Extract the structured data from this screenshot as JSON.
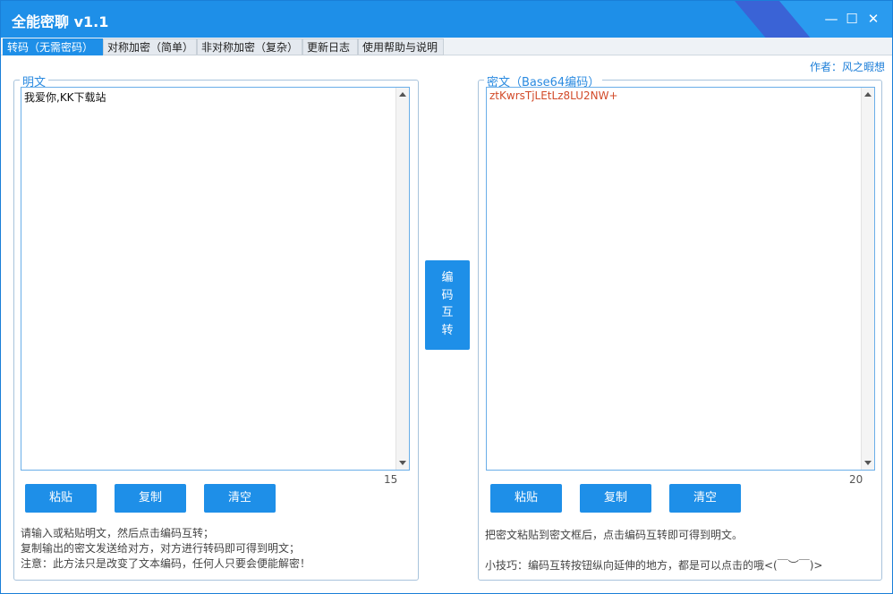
{
  "window": {
    "title": "全能密聊 v1.1",
    "minimize": "—",
    "maximize": "☐",
    "close": "✕"
  },
  "tabs": [
    {
      "label": "转码（无需密码）",
      "active": true
    },
    {
      "label": "对称加密（简单）",
      "active": false
    },
    {
      "label": "非对称加密（复杂）",
      "active": false
    },
    {
      "label": "更新日志",
      "active": false
    },
    {
      "label": "使用帮助与说明",
      "active": false
    }
  ],
  "author": "作者：风之暇想",
  "left": {
    "legend": "明文",
    "text": "我爱你,KK下载站",
    "count": "15",
    "buttons": {
      "paste": "粘贴",
      "copy": "复制",
      "clear": "清空"
    },
    "notes": [
      "请输入或粘贴明文，然后点击编码互转；",
      "复制输出的密文发送给对方，对方进行转码即可得到明文；",
      "注意：此方法只是改变了文本编码，任何人只要会便能解密！"
    ]
  },
  "middle": {
    "chars": [
      "编",
      "码",
      "互",
      "转"
    ]
  },
  "right": {
    "legend": "密文（Base64编码）",
    "text": "ztKwrsTjLEtLz8LU2NW+",
    "count": "20",
    "buttons": {
      "paste": "粘贴",
      "copy": "复制",
      "clear": "清空"
    },
    "notes": [
      "把密文粘贴到密文框后，点击编码互转即可得到明文。",
      "小技巧：编码互转按钮纵向延伸的地方，都是可以点击的哦<(￣︶￣)>"
    ]
  },
  "colors": {
    "accent": "#1e8fe8",
    "cipher_text": "#d24b2a",
    "legend": "#2a8ae0"
  }
}
